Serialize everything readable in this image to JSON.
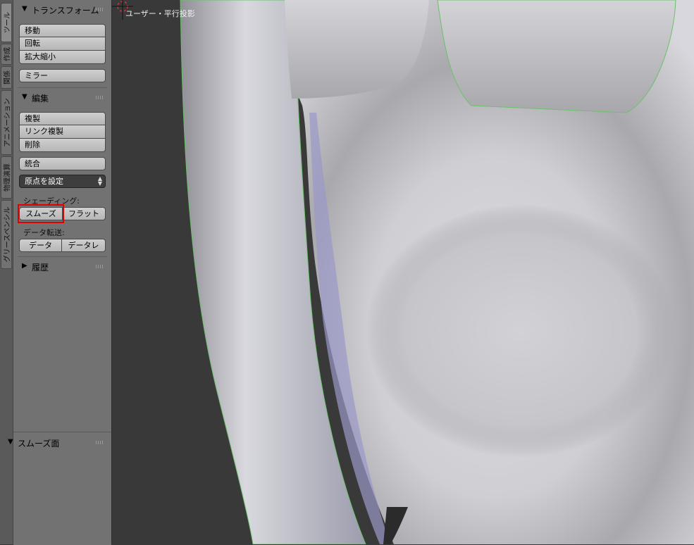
{
  "tabs": [
    "ツール",
    "作成",
    "関係",
    "アニメーション",
    "物理演算",
    "グリースペンシル"
  ],
  "active_tab": "ツール",
  "panel": {
    "transform": {
      "title": "トランスフォーム",
      "buttons": [
        "移動",
        "回転",
        "拡大縮小"
      ],
      "mirror": "ミラー"
    },
    "edit": {
      "title": "編集",
      "buttons": [
        "複製",
        "リンク複製",
        "削除"
      ],
      "join": "統合",
      "origin_dropdown": "原点を設定",
      "shading_label": "シェーディング:",
      "smooth": "スムーズ",
      "flat": "フラット",
      "data_transfer_label": "データ転送:",
      "data": "データ",
      "data_layout": "データレ"
    },
    "history": {
      "title": "履歴"
    },
    "operator": {
      "title": "スムーズ面"
    }
  },
  "viewport": {
    "label": "ユーザー・平行投影"
  },
  "colors": {
    "highlight": "#e00000",
    "selection_outline": "#4fc54f"
  }
}
